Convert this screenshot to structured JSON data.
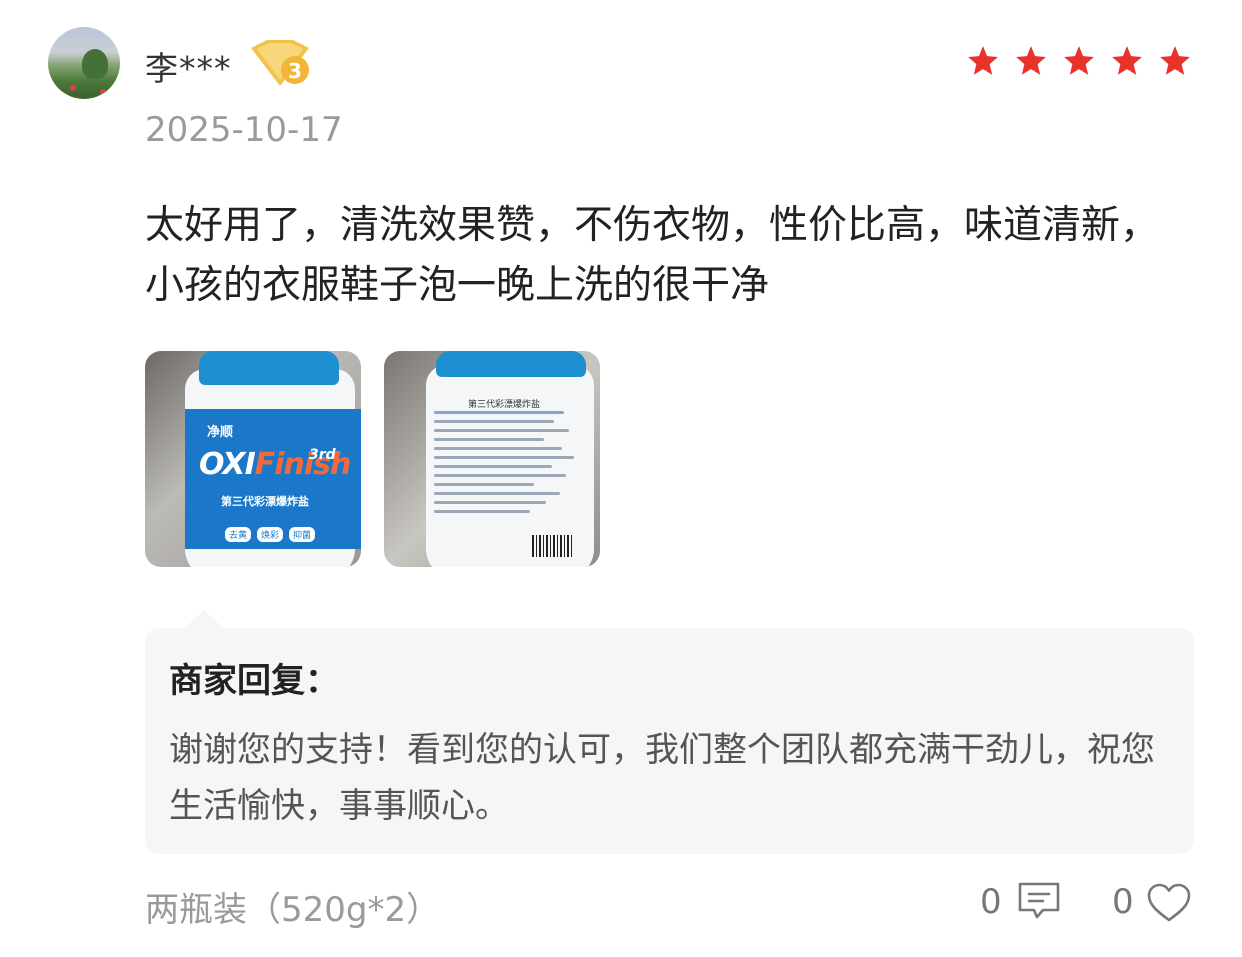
{
  "review": {
    "username": "李***",
    "vip_level": "3",
    "rating": 5,
    "date": "2025-10-17",
    "text": "太好用了，清洗效果赞，不伤衣物，性价比高，味道清新，小孩的衣服鞋子泡一晚上洗的很干净",
    "photos": [
      {
        "brand_oxi": "OXI",
        "brand_finish": "Finish",
        "brand_3rd": "3rd",
        "brand_logo": "净顺",
        "product_cn": "第三代彩漂爆炸盐",
        "tags": [
          "去黄",
          "焕彩",
          "抑菌"
        ]
      },
      {
        "back_title": "第三代彩漂爆炸盐"
      }
    ]
  },
  "merchant_reply": {
    "title": "商家回复：",
    "text": "谢谢您的支持！看到您的认可，我们整个团队都充满干劲儿，祝您生活愉快，事事顺心。"
  },
  "footer": {
    "variant": "两瓶装（520g*2）",
    "comment_count": "0",
    "like_count": "0"
  },
  "colors": {
    "star": "#e8322e",
    "badge_gold": "#f2c24c",
    "reply_bg": "#f6f6f7"
  }
}
